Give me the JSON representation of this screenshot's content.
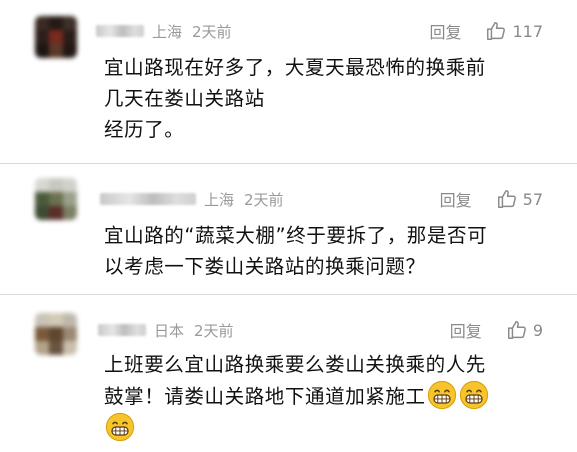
{
  "comments": [
    {
      "location": "上海",
      "time": "2天前",
      "reply_label": "回复",
      "likes": "117",
      "lines": [
        "宜山路现在好多了，大夏天最恐怖的换乘前",
        "几天在娄山关路站",
        "经历了。"
      ]
    },
    {
      "location": "上海",
      "time": "2天前",
      "reply_label": "回复",
      "likes": "57",
      "lines": [
        "宜山路的“蔬菜大棚”终于要拆了，那是否可",
        "以考虑一下娄山关路站的换乘问题？"
      ]
    },
    {
      "location": "日本",
      "time": "2天前",
      "reply_label": "回复",
      "likes": "9",
      "lines": [
        "上班要么宜山路换乘要么娄山关换乘的人先",
        "鼓掌！请娄山关路地下通道加紧施工"
      ]
    }
  ],
  "icons": {
    "like": "thumbs-up-icon",
    "emoji": "grinning-face-icon"
  },
  "colors": {
    "meta_text": "#9a9a9a",
    "action_text": "#8a8a8a",
    "body_text": "#111111",
    "divider": "#d9d9d9",
    "emoji_fill": "#f7c52b"
  }
}
